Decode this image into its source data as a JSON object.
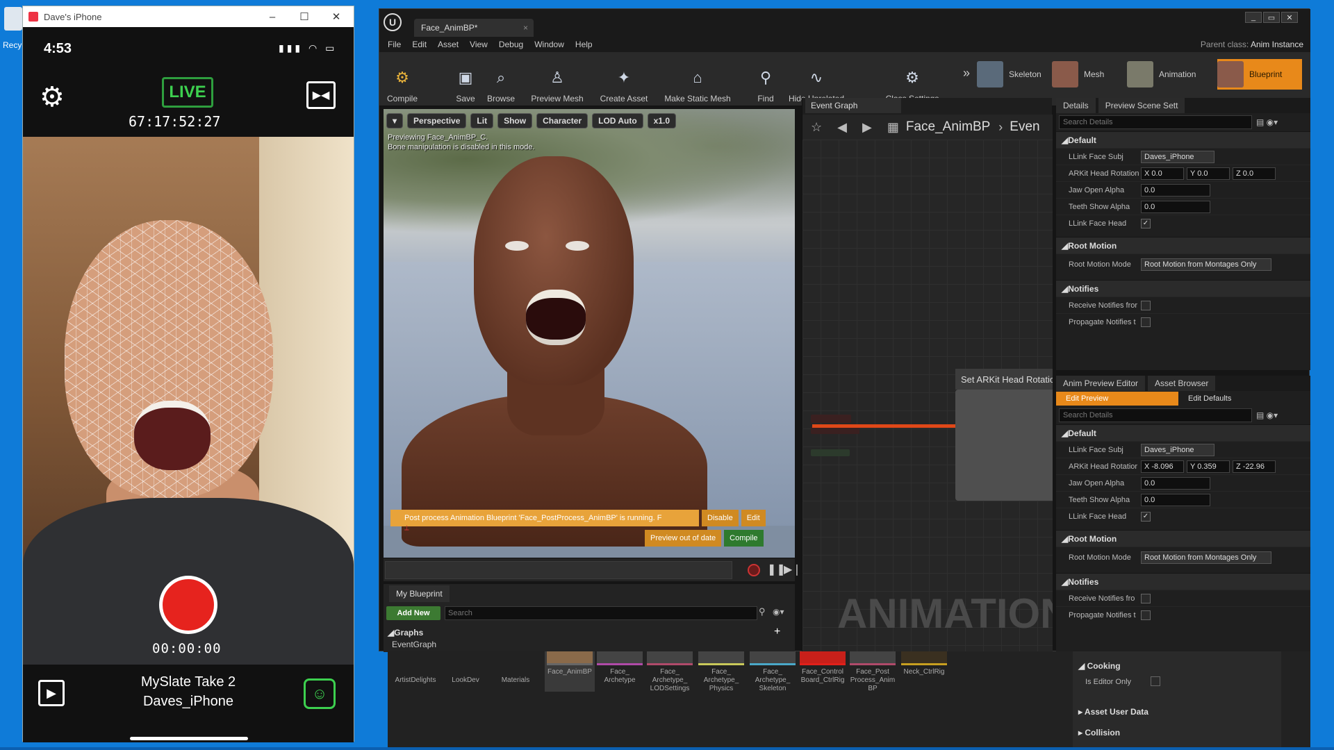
{
  "desktop": {
    "icon_label": "Recy"
  },
  "phone": {
    "window_title": "Dave's iPhone",
    "time": "4:53",
    "live": "LIVE",
    "timecode": "67:17:52:27",
    "record_time": "00:00:00",
    "slate": "MySlate Take 2",
    "device": "Daves_iPhone"
  },
  "ue": {
    "doc_tab": "Face_AnimBP*",
    "menu": [
      "File",
      "Edit",
      "Asset",
      "View",
      "Debug",
      "Window",
      "Help"
    ],
    "parent_class_label": "Parent class:",
    "parent_class_value": "Anim Instance",
    "toolbar": [
      "Compile",
      "Save",
      "Browse",
      "Preview Mesh",
      "Create Asset",
      "Make Static Mesh",
      "Find",
      "Hide Unrelated",
      "Class Settings"
    ],
    "modes": [
      "Skeleton",
      "Mesh",
      "Animation",
      "Blueprint"
    ],
    "viewport": {
      "buttons": [
        "Perspective",
        "Lit",
        "Show",
        "Character",
        "LOD Auto",
        "x1.0"
      ],
      "msg1": "Previewing Face_AnimBP_C.",
      "msg2": "Bone manipulation is disabled in this mode.",
      "warning": "Post process Animation Blueprint 'Face_PostProcess_AnimBP' is running. F",
      "disable": "Disable",
      "edit": "Edit",
      "preview_out": "Preview out of date",
      "compile": "Compile"
    },
    "my_blueprint": {
      "tab": "My Blueprint",
      "add_new": "Add New",
      "search_placeholder": "Search",
      "graphs": "Graphs",
      "event_graph": "EventGraph"
    },
    "event_graph": {
      "tab": "Event Graph",
      "crumb_name": "Face_AnimBP",
      "crumb_next": "Even",
      "node_title": "Set ARKit Head Rotation",
      "watermark": "ANIMATION"
    },
    "details": {
      "tab": "Details",
      "tab2": "Preview Scene Sett",
      "search": "Search Details",
      "default": "Default",
      "llink_face_subj": "LLink Face Subj",
      "llink_face_subj_value": "Daves_iPhone",
      "arkit_head_rotation": "ARKit Head Rotation",
      "rot_x": "X 0.0",
      "rot_y": "Y 0.0",
      "rot_z": "Z 0.0",
      "jaw_open_alpha": "Jaw Open Alpha",
      "jaw_value": "0.0",
      "teeth_show_alpha": "Teeth Show Alpha",
      "teeth_value": "0.0",
      "llink_face_head": "LLink Face Head",
      "root_motion": "Root Motion",
      "root_motion_mode": "Root Motion Mode",
      "root_motion_value": "Root Motion from Montages Only",
      "notifies": "Notifies",
      "receive_notifies": "Receive Notifies fror",
      "propagate_notifies": "Propagate Notifies t"
    },
    "preview": {
      "tab": "Anim Preview Editor",
      "tab2": "Asset Browser",
      "edit_preview": "Edit Preview",
      "edit_defaults": "Edit Defaults",
      "search": "Search Details",
      "default": "Default",
      "llink_face_subj": "LLink Face Subj",
      "llink_face_subj_value": "Daves_iPhone",
      "arkit_head_rotation": "ARKit Head Rotatior",
      "rot_x": "X -8.096",
      "rot_y": "Y 0.359",
      "rot_z": "Z -22.96",
      "jaw_open_alpha": "Jaw Open Alpha",
      "jaw_value": "0.0",
      "teeth_show_alpha": "Teeth Show Alpha",
      "teeth_value": "0.0",
      "llink_face_head": "LLink Face Head",
      "root_motion": "Root Motion",
      "root_motion_mode": "Root Motion Mode",
      "root_motion_value": "Root Motion from Montages Only",
      "notifies": "Notifies",
      "receive_notifies": "Receive Notifies fro",
      "propagate_notifies": "Propagate Notifies t"
    }
  },
  "content_browser": {
    "assets": [
      "ArtistDelights",
      "LookDev",
      "Materials",
      "Face_AnimBP",
      "Face_ Archetype",
      "Face_ Archetype_ LODSettings",
      "Face_ Archetype_ Physics",
      "Face_ Archetype_ Skeleton",
      "Face_Control Board_CtrlRig",
      "Face_Post Process_Anim BP",
      "Neck_CtrlRig"
    ],
    "cooking": "Cooking",
    "is_editor_only": "Is Editor Only",
    "asset_user_data": "Asset User Data",
    "collision": "Collision"
  },
  "colors": {
    "accent_orange": "#e8891a",
    "live_green": "#3dd04f",
    "record_red": "#e6231e",
    "wire": "#e04818"
  }
}
